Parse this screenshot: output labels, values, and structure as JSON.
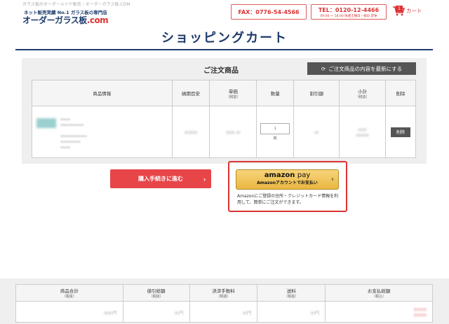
{
  "header": {
    "tagline": "ガラス板のオーダーメイド販売｜オーダーガラス板.COM",
    "logo_sub": "ネット販売実績 No.1 ガラス板の専門店",
    "logo_main": "オーダーガラス板",
    "logo_dot": ".com",
    "fax": "FAX：0776-54-4566",
    "tel": "TEL：0120-12-4466",
    "hours": "09:00 〜 18:00 除週土曜日・祝日 定休",
    "cart_count": "1",
    "cart_label": "カート",
    "colors": {
      "brand": "#1d3a6b",
      "accent": "#dd3333"
    }
  },
  "page": {
    "title": "ショッピングカート"
  },
  "order": {
    "heading": "ご注文商品",
    "refresh_label": "ご注文商品の内容を最新にする",
    "columns": [
      {
        "label": "商品情報",
        "sub": ""
      },
      {
        "label": "納期目安",
        "sub": ""
      },
      {
        "label": "単価",
        "sub": "（税抜）"
      },
      {
        "label": "数量",
        "sub": ""
      },
      {
        "label": "割引額",
        "sub": ""
      },
      {
        "label": "小計",
        "sub": "（税抜）"
      },
      {
        "label": "削除",
        "sub": ""
      }
    ],
    "row": {
      "qty_placeholder": "1",
      "qty_unit": "枚",
      "delete_label": "削除"
    }
  },
  "actions": {
    "proceed_label": "購入手続きに進む",
    "amazon_logo": "amazon",
    "amazon_pay": "pay",
    "amazon_sub": "Amazonアカウントでお支払い",
    "amazon_note": "Amazonにご登録の住所・クレジットカード情報を利用して、簡単にご注文ができます。"
  },
  "totals": {
    "columns": [
      {
        "label": "商品合計",
        "sub": "（税抜）"
      },
      {
        "label": "値引総額",
        "sub": "（税抜）"
      },
      {
        "label": "決済手数料",
        "sub": "（税抜）"
      },
      {
        "label": "送料",
        "sub": "（税抜）"
      },
      {
        "label": "お支払総額",
        "sub": "（税込）"
      }
    ],
    "unit": "円"
  }
}
